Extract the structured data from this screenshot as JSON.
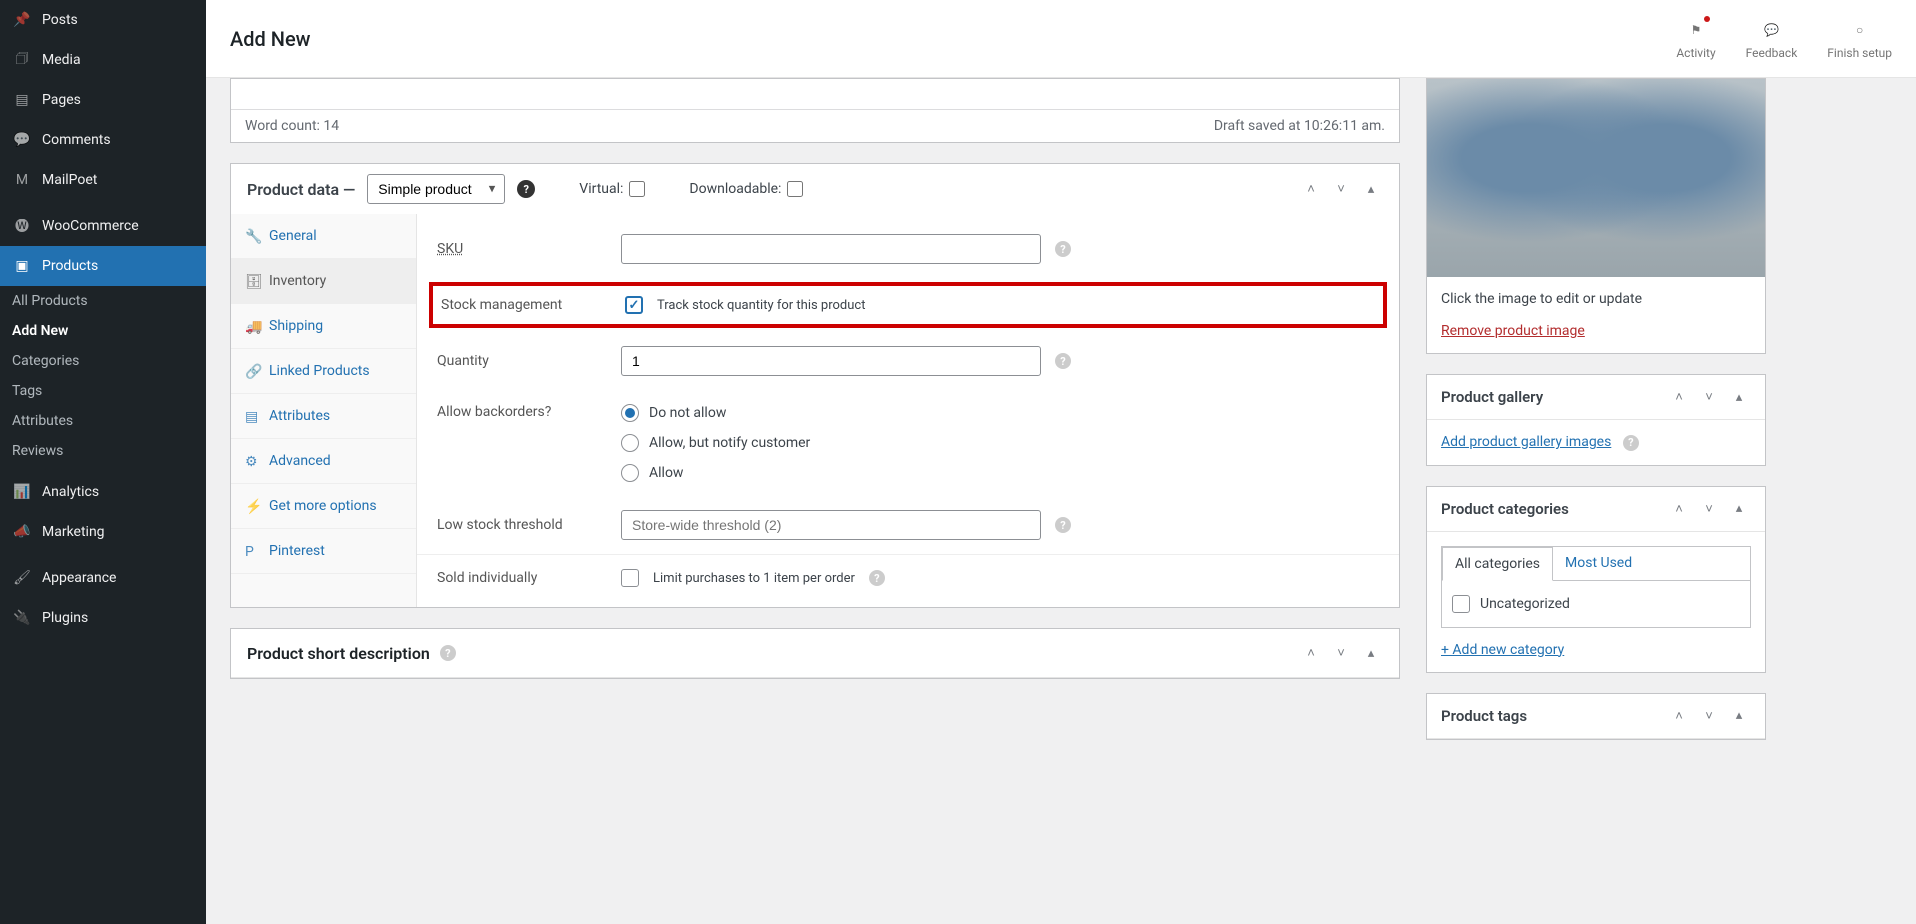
{
  "topbar": {
    "title": "Add New",
    "activity": "Activity",
    "feedback": "Feedback",
    "finish_setup": "Finish setup"
  },
  "sidebar": {
    "posts": "Posts",
    "media": "Media",
    "pages": "Pages",
    "comments": "Comments",
    "mailpoet": "MailPoet",
    "woocommerce": "WooCommerce",
    "products": "Products",
    "all_products": "All Products",
    "add_new": "Add New",
    "categories": "Categories",
    "tags": "Tags",
    "attributes": "Attributes",
    "reviews": "Reviews",
    "analytics": "Analytics",
    "marketing": "Marketing",
    "appearance": "Appearance",
    "plugins": "Plugins"
  },
  "editor": {
    "word_count": "Word count: 14",
    "draft_saved": "Draft saved at 10:26:11 am."
  },
  "product_data": {
    "title": "Product data —",
    "select": "Simple product",
    "virtual_label": "Virtual:",
    "downloadable_label": "Downloadable:",
    "tabs": {
      "general": "General",
      "inventory": "Inventory",
      "shipping": "Shipping",
      "linked": "Linked Products",
      "attributes": "Attributes",
      "advanced": "Advanced",
      "more": "Get more options",
      "pinterest": "Pinterest"
    },
    "form": {
      "sku_label": "SKU",
      "sku_value": "",
      "stock_mgmt_label": "Stock management",
      "stock_mgmt_text": "Track stock quantity for this product",
      "quantity_label": "Quantity",
      "quantity_value": "1",
      "backorders_label": "Allow backorders?",
      "backorders_opts": {
        "no": "Do not allow",
        "notify": "Allow, but notify customer",
        "yes": "Allow"
      },
      "low_stock_label": "Low stock threshold",
      "low_stock_placeholder": "Store-wide threshold (2)",
      "sold_ind_label": "Sold individually",
      "sold_ind_text": "Limit purchases to 1 item per order"
    }
  },
  "short_desc": {
    "title": "Product short description"
  },
  "image_panel": {
    "click_text": "Click the image to edit or update",
    "remove": "Remove product image"
  },
  "gallery_panel": {
    "title": "Product gallery",
    "add": "Add product gallery images"
  },
  "categories_panel": {
    "title": "Product categories",
    "tab_all": "All categories",
    "tab_most": "Most Used",
    "uncategorized": "Uncategorized",
    "add_new": "+ Add new category"
  },
  "tags_panel": {
    "title": "Product tags"
  }
}
